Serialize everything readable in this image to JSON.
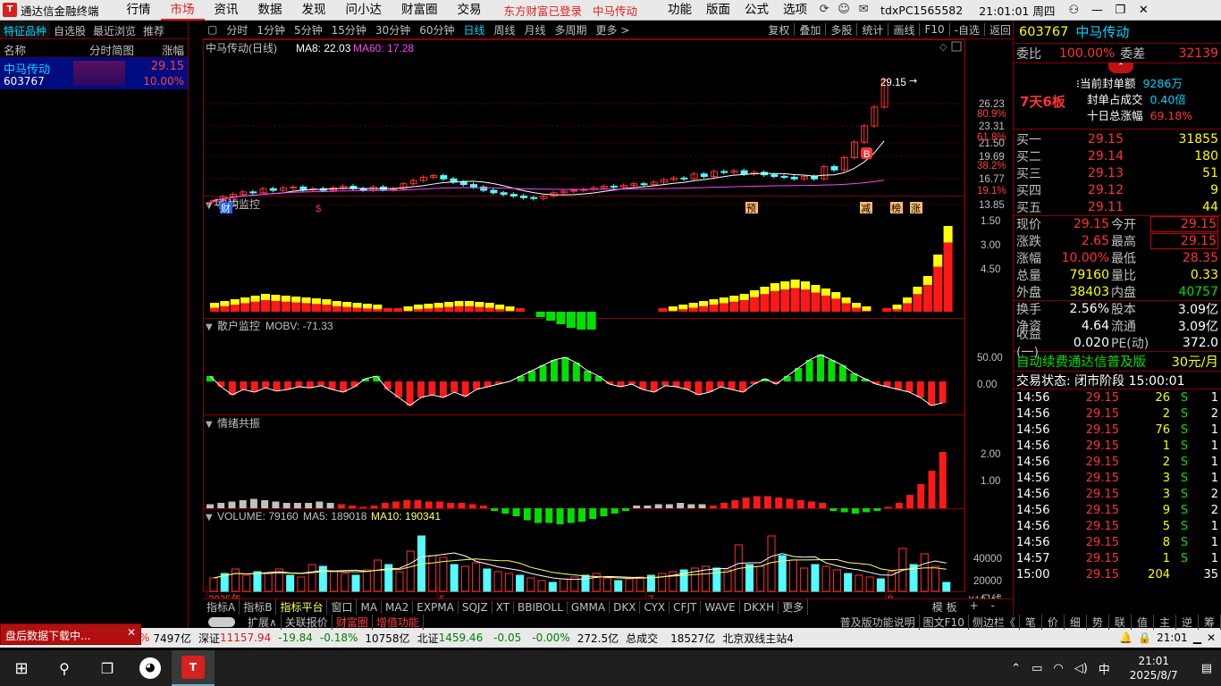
{
  "app": {
    "title": "通达信金融终端",
    "menu": [
      "行情",
      "市场",
      "资讯",
      "数据",
      "发现",
      "问小达",
      "财富圈",
      "交易"
    ],
    "active_menu": "市场",
    "login_status": "东方财富已登录",
    "login_stock": "中马传动",
    "menu_right": [
      "功能",
      "版面",
      "公式",
      "选项"
    ],
    "account": "tdxPC1565582",
    "clock": "21:01:01 周四"
  },
  "left": {
    "tabs": [
      "特征品种",
      "自选股",
      "最近浏览",
      "推荐"
    ],
    "active_tab": "特征品种",
    "header": {
      "name": "名称",
      "chart": "分时简图",
      "change": "涨幅"
    },
    "rows": [
      {
        "name": "中马传动",
        "code": "603767",
        "price": "29.15",
        "change": "10.00%"
      }
    ]
  },
  "chart_tabs": {
    "periods": [
      "分时",
      "1分钟",
      "5分钟",
      "15分钟",
      "30分钟",
      "60分钟",
      "日线",
      "周线",
      "月线",
      "多周期",
      "更多 >"
    ],
    "active_period": "日线",
    "right_tools": [
      "复权",
      "叠加",
      "多股",
      "统计",
      "画线",
      "F10",
      "-自选",
      "返回"
    ]
  },
  "main_chart": {
    "title": "中马传动(日线)",
    "ma8": "MA8: 22.03",
    "ma60": "MA60: 17.28",
    "high_label": "29.15",
    "low_label": "14.15",
    "y_ticks": [
      "26.23",
      "23.31",
      "21.50",
      "19.69",
      "16.77",
      "13.85"
    ],
    "pct_ticks": [
      "80.9%",
      "61.8%",
      "38.2%",
      "19.1%"
    ],
    "markers": [
      "财",
      "$",
      "预",
      "减",
      "榜",
      "涨"
    ],
    "b_marker": "B"
  },
  "panel_inst": {
    "title": "机构监控",
    "y_ticks": [
      "4.50",
      "3.00",
      "1.50"
    ]
  },
  "panel_retail": {
    "title": "散户监控",
    "label": "MOBV: -71.33",
    "y_ticks": [
      "50.00",
      "0.00"
    ]
  },
  "panel_emotion": {
    "title": "情绪共振",
    "y_ticks": [
      "2.00",
      "1.00"
    ]
  },
  "panel_volume": {
    "title": "VOLUME: 79160",
    "ma5": "MA5: 189018",
    "ma10": "MA10: 190341",
    "y_ticks": [
      "40000",
      "20000"
    ],
    "unit": "X10"
  },
  "x_axis": {
    "labels": [
      "2025年",
      "6",
      "7",
      "8"
    ],
    "period_label": "日线"
  },
  "indicator_tabs": [
    "指标A",
    "指标B",
    "指标平台",
    "窗口",
    "MA",
    "MA2",
    "EXPMA",
    "SQJZ",
    "XT",
    "BBIBOLL",
    "GMMA",
    "DKX",
    "CYX",
    "CFJT",
    "WAVE",
    "DKXH",
    "更多"
  ],
  "indicator_right": [
    "模 板",
    "+",
    "-"
  ],
  "bottom_tabs": [
    "扩展∧",
    "关联报价",
    "财富圈",
    "增值功能"
  ],
  "bottom_right": [
    "普及版功能说明",
    "图文F10",
    "侧边栏《"
  ],
  "right_icons": [
    "笔",
    "价",
    "细",
    "势",
    "联",
    "值",
    "主",
    "逆",
    "筹"
  ],
  "quote": {
    "code": "603767",
    "name": "中马传动",
    "weibi_label": "委比",
    "weibi": "100.00%",
    "weicha_label": "委差",
    "weicha": "32139",
    "board_tag": "7天6板",
    "seal_amount_label": "当前封单额",
    "seal_amount": "9286万",
    "seal_ratio_label": "封单占成交",
    "seal_ratio": "0.40倍",
    "ten_day_label": "十日总涨幅",
    "ten_day": "69.18%",
    "bids": [
      {
        "label": "买一",
        "price": "29.15",
        "vol": "31855"
      },
      {
        "label": "买二",
        "price": "29.14",
        "vol": "180"
      },
      {
        "label": "买三",
        "price": "29.13",
        "vol": "51"
      },
      {
        "label": "买四",
        "price": "29.12",
        "vol": "9"
      },
      {
        "label": "买五",
        "price": "29.11",
        "vol": "44"
      }
    ],
    "stats": [
      {
        "l1": "现价",
        "v1": "29.15",
        "l2": "今开",
        "v2": "29.15"
      },
      {
        "l1": "涨跌",
        "v1": "2.65",
        "l2": "最高",
        "v2": "29.15"
      },
      {
        "l1": "涨幅",
        "v1": "10.00%",
        "l2": "最低",
        "v2": "28.35"
      },
      {
        "l1": "总量",
        "v1": "79160",
        "l2": "量比",
        "v2": "0.33"
      },
      {
        "l1": "外盘",
        "v1": "38403",
        "l2": "内盘",
        "v2": "40757"
      }
    ],
    "stats2": [
      {
        "l1": "换手",
        "v1": "2.56%",
        "l2": "股本",
        "v2": "3.09亿"
      },
      {
        "l1": "净资",
        "v1": "4.64",
        "l2": "流通",
        "v2": "3.09亿"
      },
      {
        "l1": "收益(一)",
        "v1": "0.020",
        "l2": "PE(动)",
        "v2": "372.0"
      }
    ],
    "ad_text": "自动续费通达信普及版",
    "ad_price": "30元/月",
    "trade_state": "交易状态: 闭市阶段 15:00:01",
    "ticks": [
      {
        "t": "14:56",
        "p": "29.15",
        "v": "26",
        "d": "S",
        "n": "1"
      },
      {
        "t": "14:56",
        "p": "29.15",
        "v": "2",
        "d": "S",
        "n": "2"
      },
      {
        "t": "14:56",
        "p": "29.15",
        "v": "76",
        "d": "S",
        "n": "1"
      },
      {
        "t": "14:56",
        "p": "29.15",
        "v": "1",
        "d": "S",
        "n": "1"
      },
      {
        "t": "14:56",
        "p": "29.15",
        "v": "2",
        "d": "S",
        "n": "1"
      },
      {
        "t": "14:56",
        "p": "29.15",
        "v": "3",
        "d": "S",
        "n": "1"
      },
      {
        "t": "14:56",
        "p": "29.15",
        "v": "3",
        "d": "S",
        "n": "2"
      },
      {
        "t": "14:56",
        "p": "29.15",
        "v": "9",
        "d": "S",
        "n": "2"
      },
      {
        "t": "14:56",
        "p": "29.15",
        "v": "5",
        "d": "S",
        "n": "1"
      },
      {
        "t": "14:56",
        "p": "29.15",
        "v": "8",
        "d": "S",
        "n": "1"
      },
      {
        "t": "14:57",
        "p": "29.15",
        "v": "1",
        "d": "S",
        "n": "1"
      },
      {
        "t": "15:00",
        "p": "29.15",
        "v": "204",
        "d": "",
        "n": "35"
      }
    ]
  },
  "status_bar": {
    "sh_amount": "7497亿",
    "sz_label": "深证",
    "sz_index": "11157.94",
    "sz_chg": "-19.84",
    "sz_pct": "-0.18%",
    "sz_amount": "10758亿",
    "bz_label": "北证",
    "bz_index": "1459.46",
    "bz_chg": "-0.05",
    "bz_pct": "-0.00%",
    "bz_amount": "272.5亿",
    "total_label": "总成交",
    "total": "18527亿",
    "server": "北京双线主站4"
  },
  "popup": {
    "text": "盘后数据下载中..."
  },
  "taskbar": {
    "time": "21:01",
    "date": "2025/8/7",
    "ime": "中"
  }
}
